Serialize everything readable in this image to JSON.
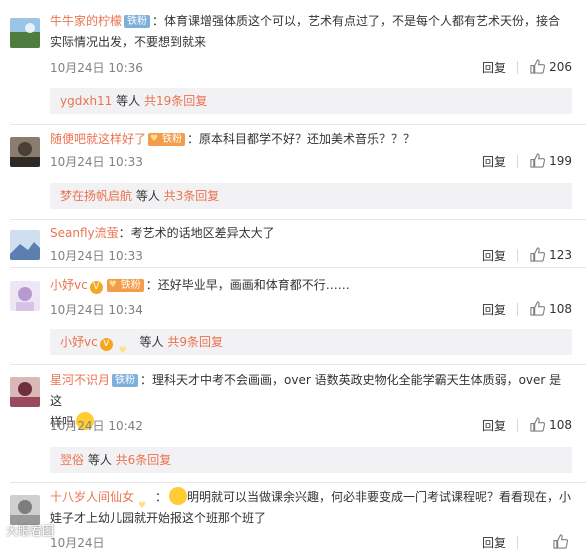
{
  "comments": [
    {
      "username": "牛牛家的柠檬",
      "badge": "铁粉",
      "text": "：体育课增强体质这个可以，艺术有点过了，不是每个人都有艺术天份，接合",
      "text2": "实际情况出发，不要想到就来",
      "time": "10月24日 10:36",
      "reply_label": "回复",
      "likes": "206",
      "replies": {
        "who": "ygdxh11",
        "mid": " 等人 ",
        "count": "共19条回复"
      },
      "avatar_color": "#5e8f5a"
    },
    {
      "username": "随便吧就这样好了",
      "badge": "铁粉",
      "text": "：原本科目都学不好？还加美术音乐？？？",
      "time": "10月24日 10:33",
      "reply_label": "回复",
      "likes": "199",
      "replies": {
        "who": "梦在扬帆启航",
        "mid": " 等人 ",
        "count": "共3条回复"
      },
      "avatar_color": "#6b6156"
    },
    {
      "username": "Seanfly流萤",
      "text": "：考艺术的话地区差异太大了",
      "time": "10月24日 10:33",
      "reply_label": "回复",
      "likes": "123",
      "avatar_color": "#8fa9c9"
    },
    {
      "username": "小妤vc",
      "badge": "铁粉",
      "text": "：还好毕业早，画画和体育都不行……",
      "time": "10月24日 10:34",
      "reply_label": "回复",
      "likes": "108",
      "replies": {
        "who": "小妤vc",
        "mid": " 等人 ",
        "count": "共9条回复"
      },
      "avatar_color": "#c8b6d9"
    },
    {
      "username": "星河不识月",
      "badge": "铁粉",
      "text": "：理科天才中考不会画画，over 语数英政史物化全能学霸天生体质弱，over 是这",
      "text2": "样吗",
      "time": "10月24日 10:42",
      "reply_label": "回复",
      "likes": "108",
      "replies": {
        "who": "翌俗",
        "mid": " 等人 ",
        "count": "共6条回复"
      },
      "avatar_color": "#7a3b4c"
    },
    {
      "username": "十八岁人间仙女",
      "text": "明明就可以当做课余兴趣，何必非要变成一门考试课程呢？看看现在，小",
      "text2": "娃子才上幼儿园就开始报这个班那个班了",
      "time": "10月24日",
      "reply_label": "回复",
      "likes": "",
      "avatar_color": "#a9a9a9"
    }
  ],
  "watermark": "大眼看图",
  "colors": {
    "link": "#eb7350",
    "meta": "#808080",
    "reply_bg": "#f2f2f5"
  }
}
